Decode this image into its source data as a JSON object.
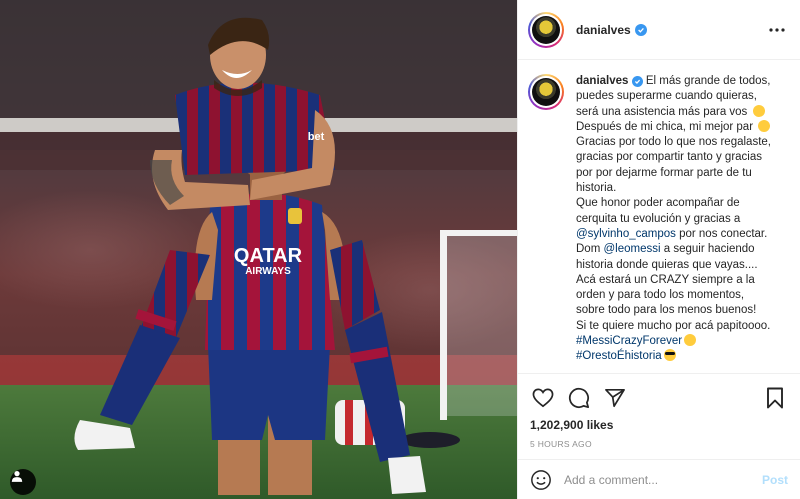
{
  "post": {
    "username": "danialves",
    "verified": true,
    "more_icon": "more-horizontal-icon",
    "caption": {
      "username": "danialves",
      "lines": [
        "El más grande de todos,",
        "puedes superarme cuando quieras,",
        "será una asistencia más para vos",
        "Después de mi chica, mi mejor par",
        "Gracias por todo lo que nos regalaste,",
        "gracias por compartir tanto y gracias",
        "por por dejarme formar parte de tu",
        "historia.",
        "Que honor poder acompañar de",
        "cerquita tu evolución y gracias a",
        "por nos conectar.",
        "Dom",
        "a seguir haciendo",
        "historia donde quieras que vayas....",
        "Acá estará un CRAZY siempre a la",
        "orden y para todo los momentos,",
        "sobre todo para los menos buenos!",
        "Si te quiere mucho por acá papitoooo."
      ],
      "mention_sylvinho": "@sylvinho_campos",
      "mention_leomessi": "@leomessi",
      "hashtag_1": "#MessiCrazyForever",
      "hashtag_2": "#OrestoÉhistoria",
      "emoji_icons": [
        "face-with-tongue-emoji",
        "grinning-sweat-emoji",
        "grinning-emoji",
        "sunglasses-emoji"
      ]
    },
    "likes": "1,202,900 likes",
    "time": "5 HOURS AGO",
    "comment_placeholder": "Add a comment...",
    "post_label": "Post",
    "action_icons": [
      "heart-icon",
      "comment-icon",
      "share-icon",
      "bookmark-icon"
    ]
  },
  "photo": {
    "jersey_sponsor_1": "QATAR",
    "jersey_sponsor_2": "AIRWAYS",
    "sleeve_sponsor": "bet",
    "tag_icon": "user-tag-icon"
  },
  "colors": {
    "link": "#00376b",
    "verified": "#3897f0",
    "post_button_disabled": "#b2dffc",
    "barca_blue": "#1d3a8a",
    "barca_red": "#a4143a"
  }
}
